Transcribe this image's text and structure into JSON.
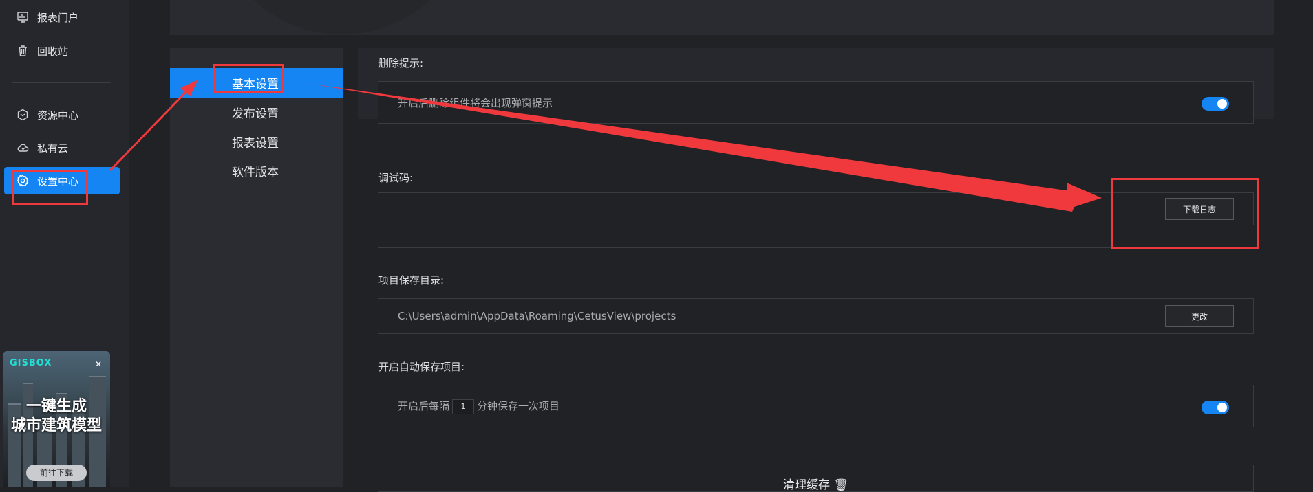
{
  "sidebar": {
    "items": [
      {
        "label": "报表门户",
        "icon": "report-portal-icon"
      },
      {
        "label": "回收站",
        "icon": "trash-icon"
      },
      {
        "label": "资源中心",
        "icon": "resource-center-icon"
      },
      {
        "label": "私有云",
        "icon": "private-cloud-icon"
      },
      {
        "label": "设置中心",
        "icon": "gear-icon",
        "active": true
      }
    ],
    "ad": {
      "logo": "GISBOX",
      "line1": "一键生成",
      "line2": "城市建筑模型",
      "button": "前往下载"
    }
  },
  "sub_nav": {
    "items": [
      "基本设置",
      "发布设置",
      "报表设置",
      "软件版本"
    ],
    "active_index": 0
  },
  "settings": {
    "delete_prompt": {
      "label": "删除提示:",
      "description": "开启后删除组件将会出现弹窗提示",
      "enabled": true
    },
    "debug_code": {
      "label": "调试码:",
      "button": "下载日志"
    },
    "project_dir": {
      "label": "项目保存目录:",
      "path": "C:\\Users\\admin\\AppData\\Roaming\\CetusView\\projects",
      "button": "更改"
    },
    "autosave": {
      "label": "开启自动保存项目:",
      "text_before": "开启后每隔",
      "interval": "1",
      "text_after": "分钟保存一次项目",
      "enabled": true
    },
    "clear_cache": {
      "label": "清理缓存"
    }
  },
  "colors": {
    "accent": "#1585f3",
    "background": "#212226",
    "sidebar": "#26272c",
    "annotation": "#f0393d"
  }
}
